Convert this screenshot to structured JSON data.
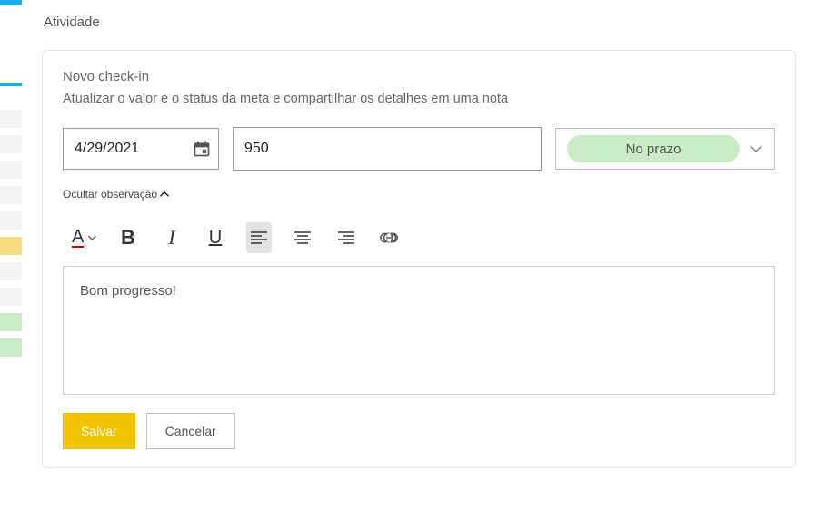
{
  "labels": {
    "activity": "Atividade",
    "new_checkin": "Novo check-in",
    "subtitle": "Atualizar o valor e o status da meta e compartilhar os detalhes em uma nota",
    "hide_note": "Ocultar observação"
  },
  "form": {
    "date": "4/29/2021",
    "value": "950",
    "status": "No prazo"
  },
  "note": "Bom progresso!",
  "buttons": {
    "save": "Salvar",
    "cancel": "Cancelar"
  }
}
